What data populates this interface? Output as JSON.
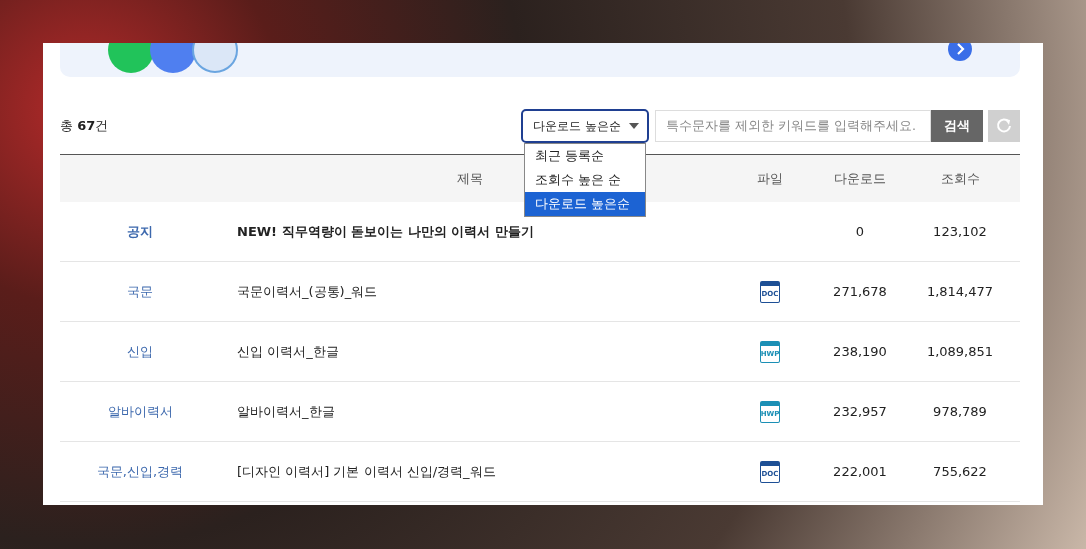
{
  "summary": {
    "prefix": "총 ",
    "count": "67",
    "suffix": "건"
  },
  "sort": {
    "value": "다운로드 높은순",
    "expanded": true,
    "options": [
      {
        "label": "최근 등록순",
        "selected": false
      },
      {
        "label": "조회수 높은 순",
        "selected": false
      },
      {
        "label": "다운로드 높은순",
        "selected": true
      }
    ]
  },
  "search": {
    "placeholder": "특수문자를 제외한 키워드를 입력해주세요.",
    "button": "검색"
  },
  "table": {
    "columns": [
      "제목",
      "파일",
      "다운로드",
      "조회수"
    ],
    "rows": [
      {
        "category": "공지",
        "title": "NEW! 직무역량이 돋보이는 나만의 이력서 만들기",
        "notice": true,
        "downloads": "0",
        "views": "123,102"
      },
      {
        "category": "국문",
        "title": "국문이력서_(공통)_워드",
        "notice": false,
        "file": {
          "kind": "doc",
          "label": "DOC"
        },
        "downloads": "271,678",
        "views": "1,814,477"
      },
      {
        "category": "신입",
        "title": "신입 이력서_한글",
        "notice": false,
        "file": {
          "kind": "hwp",
          "label": "HWP"
        },
        "downloads": "238,190",
        "views": "1,089,851"
      },
      {
        "category": "알바이력서",
        "title": "알바이력서_한글",
        "notice": false,
        "file": {
          "kind": "hwp",
          "label": "HWP"
        },
        "downloads": "232,957",
        "views": "978,789"
      },
      {
        "category": "국문,신입,경력",
        "title": "[디자인 이력서] 기본 이력서 신입/경력_워드",
        "notice": false,
        "file": {
          "kind": "doc",
          "label": "DOC"
        },
        "downloads": "222,001",
        "views": "755,622"
      }
    ]
  }
}
